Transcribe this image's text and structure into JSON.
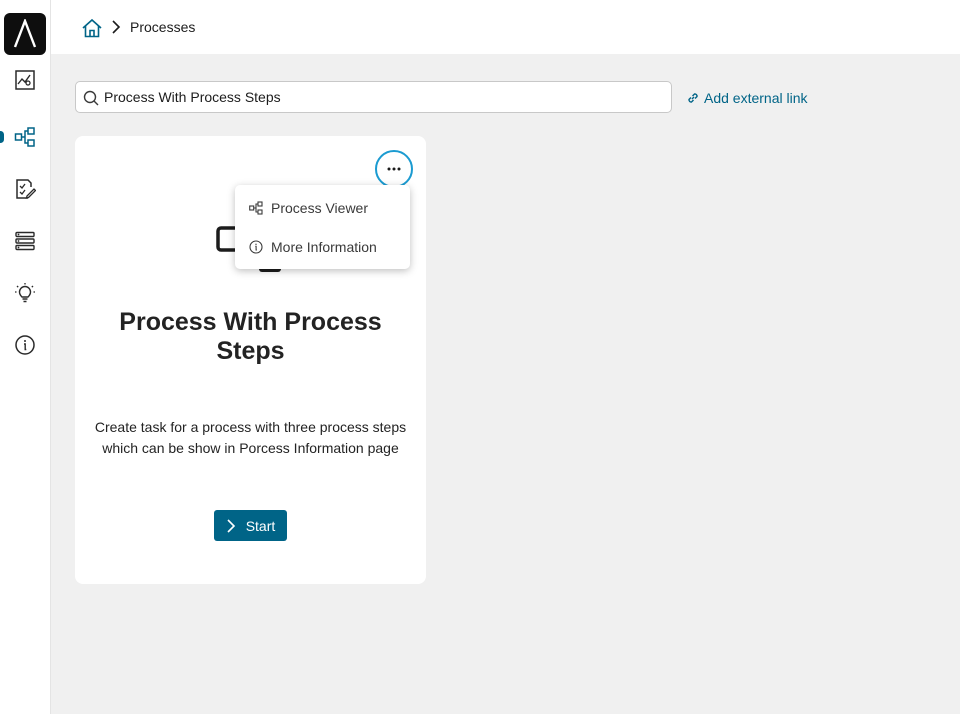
{
  "sidebar": {
    "logo": "logo-icon",
    "items": [
      {
        "name": "dashboard",
        "icon": "chart-image-icon"
      },
      {
        "name": "processes",
        "icon": "process-flow-icon",
        "active": true
      },
      {
        "name": "tasks",
        "icon": "document-edit-icon"
      },
      {
        "name": "lists",
        "icon": "list-icon"
      },
      {
        "name": "ideas",
        "icon": "lightbulb-icon"
      },
      {
        "name": "info",
        "icon": "info-icon"
      }
    ]
  },
  "breadcrumb": {
    "home_icon": "home-icon",
    "current": "Processes"
  },
  "search": {
    "value": "Process With Process Steps"
  },
  "external_link": {
    "label": "Add external link",
    "icon": "link-icon"
  },
  "card": {
    "title": "Process With Process Steps",
    "description": "Create task for a process with three process steps which can be show in Porcess Information page",
    "start_label": "Start",
    "more_icon": "ellipsis-icon"
  },
  "menu": {
    "items": [
      {
        "label": "Process Viewer",
        "icon": "process-flow-icon"
      },
      {
        "label": "More Information",
        "icon": "info-icon"
      }
    ]
  },
  "colors": {
    "accent": "#006487",
    "focus_ring": "#1b9bd1",
    "background": "#f0f0f0"
  }
}
